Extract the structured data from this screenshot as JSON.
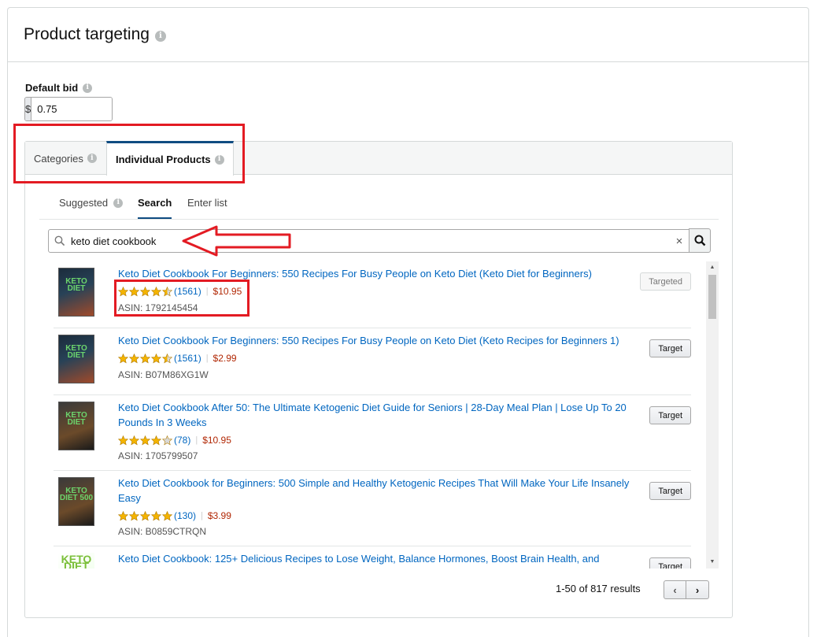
{
  "header": {
    "title": "Product targeting"
  },
  "bid": {
    "label": "Default bid",
    "currency": "$",
    "value": "0.75"
  },
  "tabs": [
    {
      "label": "Categories",
      "active": false
    },
    {
      "label": "Individual Products",
      "active": true
    }
  ],
  "subtabs": [
    {
      "label": "Suggested",
      "active": false
    },
    {
      "label": "Search",
      "active": true
    },
    {
      "label": "Enter list",
      "active": false
    }
  ],
  "search": {
    "query": "keto diet cookbook",
    "clear": "×"
  },
  "results": [
    {
      "title": "Keto Diet Cookbook For Beginners: 550 Recipes For Busy People on Keto Diet (Keto Diet for Beginners)",
      "rating": 4.5,
      "count": "(1561)",
      "price": "$10.95",
      "asin": "ASIN: 1792145454",
      "action": "Targeted",
      "cover_title": "KETO DIET"
    },
    {
      "title": "Keto Diet Cookbook For Beginners: 550 Recipes For Busy People on Keto Diet (Keto Recipes for Beginners 1)",
      "rating": 4.5,
      "count": "(1561)",
      "price": "$2.99",
      "asin": "ASIN: B07M86XG1W",
      "action": "Target",
      "cover_title": "KETO DIET"
    },
    {
      "title": "Keto Diet Cookbook After 50: The Ultimate Ketogenic Diet Guide for Seniors | 28-Day Meal Plan | Lose Up To 20 Pounds In 3 Weeks",
      "rating": 4,
      "count": "(78)",
      "price": "$10.95",
      "asin": "ASIN: 1705799507",
      "action": "Target",
      "cover_title": "KETO DIET"
    },
    {
      "title": "Keto Diet Cookbook for Beginners: 500 Simple and Healthy Ketogenic Recipes That Will Make Your Life Insanely Easy",
      "rating": 5,
      "count": "(130)",
      "price": "$3.99",
      "asin": "ASIN: B0859CTRQN",
      "action": "Target",
      "cover_title": "KETO DIET 500"
    },
    {
      "title": "Keto Diet Cookbook: 125+ Delicious Recipes to Lose Weight, Balance Hormones, Boost Brain Health, and",
      "rating": 0,
      "count": "",
      "price": "",
      "asin": "",
      "action": "Target",
      "cover_title": "KETO DIET"
    }
  ],
  "pagination": {
    "summary": "1-50 of 817 results",
    "prev": "‹",
    "next": "›"
  },
  "colors": {
    "link": "#0066c0",
    "price": "#b12704",
    "annotation": "#e31b23",
    "star": "#f4b400",
    "active_tab": "#0f4c81"
  }
}
